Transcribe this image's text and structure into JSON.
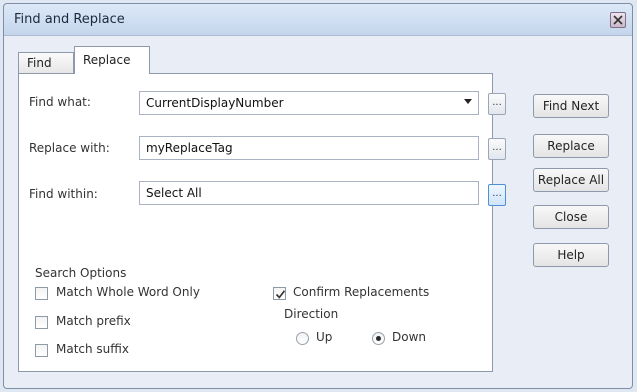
{
  "window": {
    "title": "Find and Replace"
  },
  "tabs": [
    {
      "label": "Find"
    },
    {
      "label": "Replace"
    }
  ],
  "fields": {
    "find_what": {
      "label": "Find what:",
      "value": "CurrentDisplayNumber"
    },
    "replace_with": {
      "label": "Replace with:",
      "value": "myReplaceTag"
    },
    "find_within": {
      "label": "Find within:",
      "value": "Select All"
    },
    "browse_label": "..."
  },
  "search_options": {
    "title": "Search Options",
    "match_whole_word": {
      "label": "Match Whole Word Only",
      "checked": false
    },
    "match_prefix": {
      "label": "Match prefix",
      "checked": false
    },
    "match_suffix": {
      "label": "Match suffix",
      "checked": false
    },
    "confirm_replacements": {
      "label": "Confirm Replacements",
      "checked": true
    },
    "direction": {
      "label": "Direction",
      "up": "Up",
      "down": "Down",
      "selected": "Down"
    }
  },
  "buttons": {
    "find_next": "Find Next",
    "replace": "Replace",
    "replace_all": "Replace All",
    "close": "Close",
    "help": "Help"
  }
}
